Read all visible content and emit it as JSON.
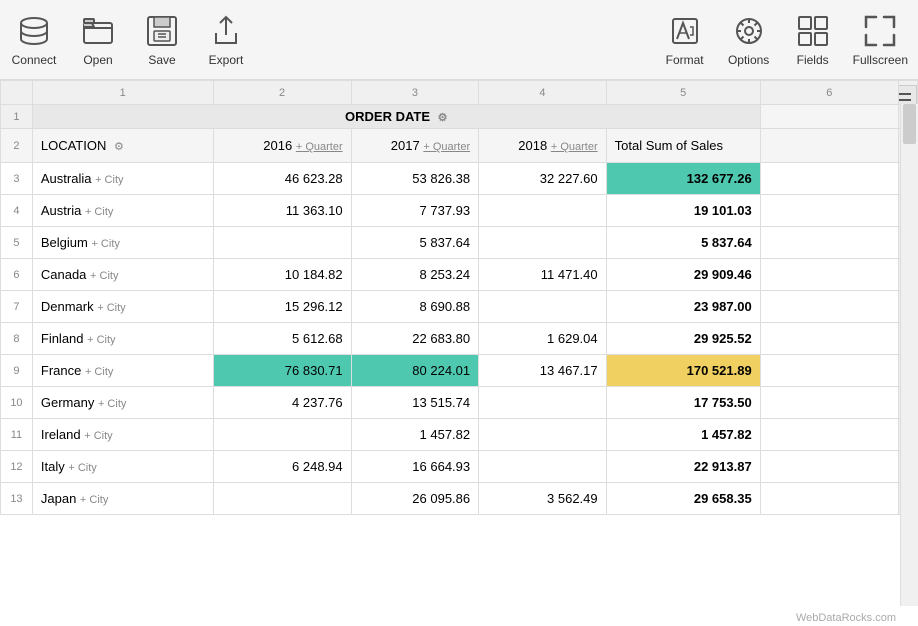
{
  "toolbar": {
    "left_buttons": [
      {
        "label": "Connect",
        "icon": "database-icon"
      },
      {
        "label": "Open",
        "icon": "folder-icon"
      },
      {
        "label": "Save",
        "icon": "save-icon"
      },
      {
        "label": "Export",
        "icon": "export-icon"
      }
    ],
    "right_buttons": [
      {
        "label": "Format",
        "icon": "format-icon"
      },
      {
        "label": "Options",
        "icon": "gear-icon"
      },
      {
        "label": "Fields",
        "icon": "fields-icon"
      },
      {
        "label": "Fullscreen",
        "icon": "fullscreen-icon"
      }
    ]
  },
  "grid": {
    "col_numbers": [
      "",
      "1",
      "2",
      "3",
      "4",
      "5",
      "6",
      ""
    ],
    "row1": {
      "row_num": "1",
      "label": "ORDER DATE",
      "gear": "⚙"
    },
    "row2": {
      "row_num": "2",
      "location_label": "LOCATION",
      "gear": "⚙",
      "col2": "2016",
      "col2_plus": "+ Quarter",
      "col3": "2017",
      "col3_plus": "+ Quarter",
      "col4": "2018",
      "col4_plus": "+ Quarter",
      "col5": "Total Sum of Sales"
    },
    "rows": [
      {
        "num": "3",
        "location": "Australia",
        "plus_city": "+ City",
        "v2016": "46 623.28",
        "v2017": "53 826.38",
        "v2018": "32 227.60",
        "total": "132 677.26",
        "total_highlight": "teal"
      },
      {
        "num": "4",
        "location": "Austria",
        "plus_city": "+ City",
        "v2016": "11 363.10",
        "v2017": "7 737.93",
        "v2018": "",
        "total": "19 101.03"
      },
      {
        "num": "5",
        "location": "Belgium",
        "plus_city": "+ City",
        "v2016": "",
        "v2017": "5 837.64",
        "v2018": "",
        "total": "5 837.64"
      },
      {
        "num": "6",
        "location": "Canada",
        "plus_city": "+ City",
        "v2016": "10 184.82",
        "v2017": "8 253.24",
        "v2018": "11 471.40",
        "total": "29 909.46"
      },
      {
        "num": "7",
        "location": "Denmark",
        "plus_city": "+ City",
        "v2016": "15 296.12",
        "v2017": "8 690.88",
        "v2018": "",
        "total": "23 987.00"
      },
      {
        "num": "8",
        "location": "Finland",
        "plus_city": "+ City",
        "v2016": "5 612.68",
        "v2017": "22 683.80",
        "v2018": "1 629.04",
        "total": "29 925.52"
      },
      {
        "num": "9",
        "location": "France",
        "plus_city": "+ City",
        "v2016": "76 830.71",
        "v2017": "80 224.01",
        "v2018": "13 467.17",
        "total": "170 521.89",
        "v2016_highlight": "teal",
        "v2017_highlight": "teal",
        "total_highlight": "yellow"
      },
      {
        "num": "10",
        "location": "Germany",
        "plus_city": "+ City",
        "v2016": "4 237.76",
        "v2017": "13 515.74",
        "v2018": "",
        "total": "17 753.50"
      },
      {
        "num": "11",
        "location": "Ireland",
        "plus_city": "+ City",
        "v2016": "",
        "v2017": "1 457.82",
        "v2018": "",
        "total": "1 457.82"
      },
      {
        "num": "12",
        "location": "Italy",
        "plus_city": "+ City",
        "v2016": "6 248.94",
        "v2017": "16 664.93",
        "v2018": "",
        "total": "22 913.87"
      },
      {
        "num": "13",
        "location": "Japan",
        "plus_city": "+ City",
        "v2016": "",
        "v2017": "26 095.86",
        "v2018": "3 562.49",
        "total": "29 658.35"
      }
    ]
  },
  "watermark": "WebDataRocks.com"
}
